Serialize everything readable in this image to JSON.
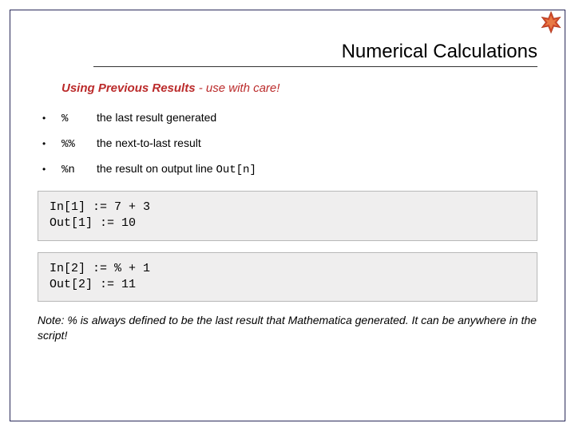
{
  "header": {
    "title": "Numerical Calculations"
  },
  "subhead": {
    "strong": "Using Previous Results",
    "rest": " - use with care!"
  },
  "bullets": [
    {
      "symbol": "%",
      "desc_prefix": "the last result generated",
      "mono": ""
    },
    {
      "symbol": "%%",
      "desc_prefix": "the next-to-last result",
      "mono": ""
    },
    {
      "symbol": "%n",
      "desc_prefix": "the result on output line ",
      "mono": "Out[n]"
    }
  ],
  "code": {
    "block1": "In[1] := 7 + 3\nOut[1] := 10",
    "block2": "In[2] := % + 1\nOut[2] := 11"
  },
  "note": "Note: % is always defined to be the last result that Mathematica generated. It can be anywhere in the script!"
}
